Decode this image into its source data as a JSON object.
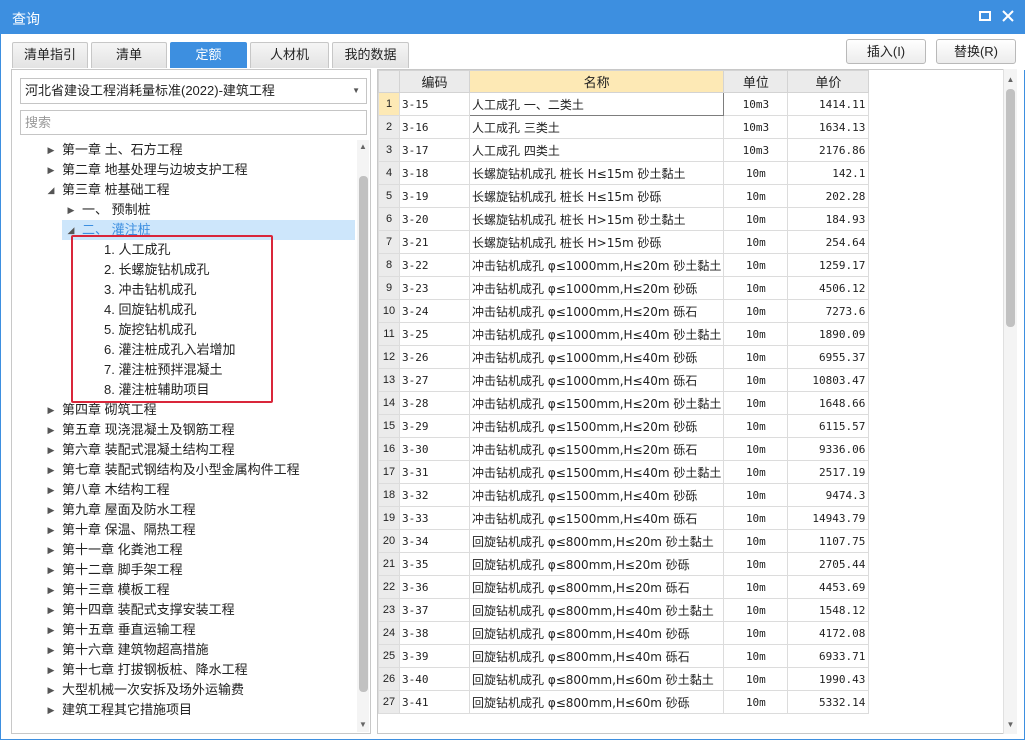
{
  "window": {
    "title": "查询",
    "maximize_icon": "maximize-icon",
    "close_icon": "close-icon",
    "accent_color": "#3d8fe0"
  },
  "tabs": [
    {
      "label": "清单指引",
      "active": false
    },
    {
      "label": "清单",
      "active": false
    },
    {
      "label": "定额",
      "active": true
    },
    {
      "label": "人材机",
      "active": false
    },
    {
      "label": "我的数据",
      "active": false
    }
  ],
  "actions": {
    "insert_label": "插入(I)",
    "replace_label": "替换(R)"
  },
  "left": {
    "library_selected": "河北省建设工程消耗量标准(2022)-建筑工程",
    "search_placeholder": "搜索",
    "search_value": "",
    "tree": [
      {
        "label": "第一章 土、石方工程",
        "level": 0,
        "state": "collapsed"
      },
      {
        "label": "第二章 地基处理与边坡支护工程",
        "level": 0,
        "state": "collapsed"
      },
      {
        "label": "第三章 桩基础工程",
        "level": 0,
        "state": "expanded"
      },
      {
        "label": "一、 预制桩",
        "level": 1,
        "state": "collapsed"
      },
      {
        "label": "二、 灌注桩",
        "level": 1,
        "state": "expanded",
        "selected": true
      },
      {
        "label": "1. 人工成孔",
        "level": 2,
        "state": "leaf"
      },
      {
        "label": "2. 长螺旋钻机成孔",
        "level": 2,
        "state": "leaf"
      },
      {
        "label": "3. 冲击钻机成孔",
        "level": 2,
        "state": "leaf"
      },
      {
        "label": "4. 回旋钻机成孔",
        "level": 2,
        "state": "leaf"
      },
      {
        "label": "5. 旋挖钻机成孔",
        "level": 2,
        "state": "leaf"
      },
      {
        "label": "6. 灌注桩成孔入岩增加",
        "level": 2,
        "state": "leaf"
      },
      {
        "label": "7. 灌注桩预拌混凝土",
        "level": 2,
        "state": "leaf"
      },
      {
        "label": "8. 灌注桩辅助项目",
        "level": 2,
        "state": "leaf"
      },
      {
        "label": "第四章 砌筑工程",
        "level": 0,
        "state": "collapsed"
      },
      {
        "label": "第五章 现浇混凝土及钢筋工程",
        "level": 0,
        "state": "collapsed"
      },
      {
        "label": "第六章 装配式混凝土结构工程",
        "level": 0,
        "state": "collapsed"
      },
      {
        "label": "第七章 装配式钢结构及小型金属构件工程",
        "level": 0,
        "state": "collapsed"
      },
      {
        "label": "第八章 木结构工程",
        "level": 0,
        "state": "collapsed"
      },
      {
        "label": "第九章 屋面及防水工程",
        "level": 0,
        "state": "collapsed"
      },
      {
        "label": "第十章 保温、隔热工程",
        "level": 0,
        "state": "collapsed"
      },
      {
        "label": "第十一章 化粪池工程",
        "level": 0,
        "state": "collapsed"
      },
      {
        "label": "第十二章 脚手架工程",
        "level": 0,
        "state": "collapsed"
      },
      {
        "label": "第十三章 模板工程",
        "level": 0,
        "state": "collapsed"
      },
      {
        "label": "第十四章 装配式支撑安装工程",
        "level": 0,
        "state": "collapsed"
      },
      {
        "label": "第十五章 垂直运输工程",
        "level": 0,
        "state": "collapsed"
      },
      {
        "label": "第十六章 建筑物超高措施",
        "level": 0,
        "state": "collapsed"
      },
      {
        "label": "第十七章 打拔钢板桩、降水工程",
        "level": 0,
        "state": "collapsed"
      },
      {
        "label": "大型机械一次安拆及场外运输费",
        "level": 0,
        "state": "collapsed"
      },
      {
        "label": "建筑工程其它措施项目",
        "level": 0,
        "state": "collapsed"
      }
    ]
  },
  "grid": {
    "headers": {
      "code": "编码",
      "name": "名称",
      "unit": "单位",
      "price": "单价"
    },
    "rows": [
      {
        "n": "1",
        "code": "3-15",
        "name": "人工成孔 一、二类土",
        "unit": "10m3",
        "price": "1414.11",
        "current": true
      },
      {
        "n": "2",
        "code": "3-16",
        "name": "人工成孔 三类土",
        "unit": "10m3",
        "price": "1634.13"
      },
      {
        "n": "3",
        "code": "3-17",
        "name": "人工成孔 四类土",
        "unit": "10m3",
        "price": "2176.86"
      },
      {
        "n": "4",
        "code": "3-18",
        "name": "长螺旋钻机成孔 桩长 H≤15m 砂土黏土",
        "unit": "10m",
        "price": "142.1"
      },
      {
        "n": "5",
        "code": "3-19",
        "name": "长螺旋钻机成孔 桩长 H≤15m 砂砾",
        "unit": "10m",
        "price": "202.28"
      },
      {
        "n": "6",
        "code": "3-20",
        "name": "长螺旋钻机成孔 桩长 H>15m 砂土黏土",
        "unit": "10m",
        "price": "184.93"
      },
      {
        "n": "7",
        "code": "3-21",
        "name": "长螺旋钻机成孔 桩长 H>15m 砂砾",
        "unit": "10m",
        "price": "254.64"
      },
      {
        "n": "8",
        "code": "3-22",
        "name": "冲击钻机成孔 φ≤1000mm,H≤20m 砂土黏土",
        "unit": "10m",
        "price": "1259.17"
      },
      {
        "n": "9",
        "code": "3-23",
        "name": "冲击钻机成孔 φ≤1000mm,H≤20m 砂砾",
        "unit": "10m",
        "price": "4506.12"
      },
      {
        "n": "10",
        "code": "3-24",
        "name": "冲击钻机成孔 φ≤1000mm,H≤20m 砾石",
        "unit": "10m",
        "price": "7273.6"
      },
      {
        "n": "11",
        "code": "3-25",
        "name": "冲击钻机成孔 φ≤1000mm,H≤40m 砂土黏土",
        "unit": "10m",
        "price": "1890.09"
      },
      {
        "n": "12",
        "code": "3-26",
        "name": "冲击钻机成孔 φ≤1000mm,H≤40m 砂砾",
        "unit": "10m",
        "price": "6955.37"
      },
      {
        "n": "13",
        "code": "3-27",
        "name": "冲击钻机成孔 φ≤1000mm,H≤40m 砾石",
        "unit": "10m",
        "price": "10803.47"
      },
      {
        "n": "14",
        "code": "3-28",
        "name": "冲击钻机成孔 φ≤1500mm,H≤20m 砂土黏土",
        "unit": "10m",
        "price": "1648.66"
      },
      {
        "n": "15",
        "code": "3-29",
        "name": "冲击钻机成孔 φ≤1500mm,H≤20m 砂砾",
        "unit": "10m",
        "price": "6115.57"
      },
      {
        "n": "16",
        "code": "3-30",
        "name": "冲击钻机成孔 φ≤1500mm,H≤20m 砾石",
        "unit": "10m",
        "price": "9336.06"
      },
      {
        "n": "17",
        "code": "3-31",
        "name": "冲击钻机成孔 φ≤1500mm,H≤40m 砂土黏土",
        "unit": "10m",
        "price": "2517.19"
      },
      {
        "n": "18",
        "code": "3-32",
        "name": "冲击钻机成孔 φ≤1500mm,H≤40m 砂砾",
        "unit": "10m",
        "price": "9474.3"
      },
      {
        "n": "19",
        "code": "3-33",
        "name": "冲击钻机成孔 φ≤1500mm,H≤40m 砾石",
        "unit": "10m",
        "price": "14943.79"
      },
      {
        "n": "20",
        "code": "3-34",
        "name": "回旋钻机成孔 φ≤800mm,H≤20m 砂土黏土",
        "unit": "10m",
        "price": "1107.75"
      },
      {
        "n": "21",
        "code": "3-35",
        "name": "回旋钻机成孔 φ≤800mm,H≤20m 砂砾",
        "unit": "10m",
        "price": "2705.44"
      },
      {
        "n": "22",
        "code": "3-36",
        "name": "回旋钻机成孔 φ≤800mm,H≤20m 砾石",
        "unit": "10m",
        "price": "4453.69"
      },
      {
        "n": "23",
        "code": "3-37",
        "name": "回旋钻机成孔 φ≤800mm,H≤40m 砂土黏土",
        "unit": "10m",
        "price": "1548.12"
      },
      {
        "n": "24",
        "code": "3-38",
        "name": "回旋钻机成孔 φ≤800mm,H≤40m 砂砾",
        "unit": "10m",
        "price": "4172.08"
      },
      {
        "n": "25",
        "code": "3-39",
        "name": "回旋钻机成孔 φ≤800mm,H≤40m 砾石",
        "unit": "10m",
        "price": "6933.71"
      },
      {
        "n": "26",
        "code": "3-40",
        "name": "回旋钻机成孔 φ≤800mm,H≤60m 砂土黏土",
        "unit": "10m",
        "price": "1990.43"
      },
      {
        "n": "27",
        "code": "3-41",
        "name": "回旋钻机成孔 φ≤800mm,H≤60m 砂砾",
        "unit": "10m",
        "price": "5332.14"
      }
    ]
  }
}
